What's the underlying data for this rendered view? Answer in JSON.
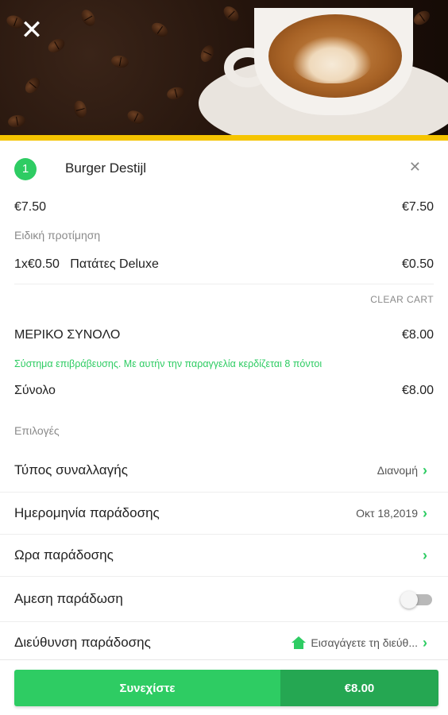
{
  "header": {
    "close_icon": "close-icon",
    "image": "coffee-cup-with-latte-art-on-coffee-beans"
  },
  "cart": {
    "items": [
      {
        "quantity": "1",
        "name": "Burger Destijl",
        "unit_price": "€7.50",
        "line_total": "€7.50",
        "special_preference_label": "Ειδική προτίμηση",
        "extras": [
          {
            "qty_price": "1x€0.50",
            "name": "Πατάτες Deluxe",
            "price": "€0.50"
          }
        ]
      }
    ],
    "clear_cart_label": "CLEAR CART"
  },
  "summary": {
    "subtotal_label": "ΜΕΡΙΚΟ ΣΥΝΟΛΟ",
    "subtotal_value": "€8.00",
    "reward_note": "Σύστημα επιβράβευσης. Με αυτήν την παραγγελία κερδίζεται 8 πόντοι",
    "total_label": "Σύνολο",
    "total_value": "€8.00"
  },
  "options": {
    "section_label": "Επιλογές",
    "transaction_type": {
      "label": "Τύπος συναλλαγής",
      "value": "Διανομή"
    },
    "delivery_date": {
      "label": "Ημερομηνία παράδοσης",
      "value": "Οκτ 18,2019"
    },
    "delivery_time": {
      "label": "Ωρα παράδοσης",
      "value": ""
    },
    "immediate_delivery": {
      "label": "Αμεση παράδωση",
      "enabled": false
    },
    "delivery_address": {
      "label": "Διεύθυνση παράδοσης",
      "value": "Εισαγάγετε τη διεύθ..."
    }
  },
  "checkout": {
    "continue_label": "Συνεχίστε",
    "amount": "€8.00"
  },
  "colors": {
    "accent_green": "#2ecc63",
    "dark_green": "#25a752",
    "header_stripe": "#f5c400"
  }
}
